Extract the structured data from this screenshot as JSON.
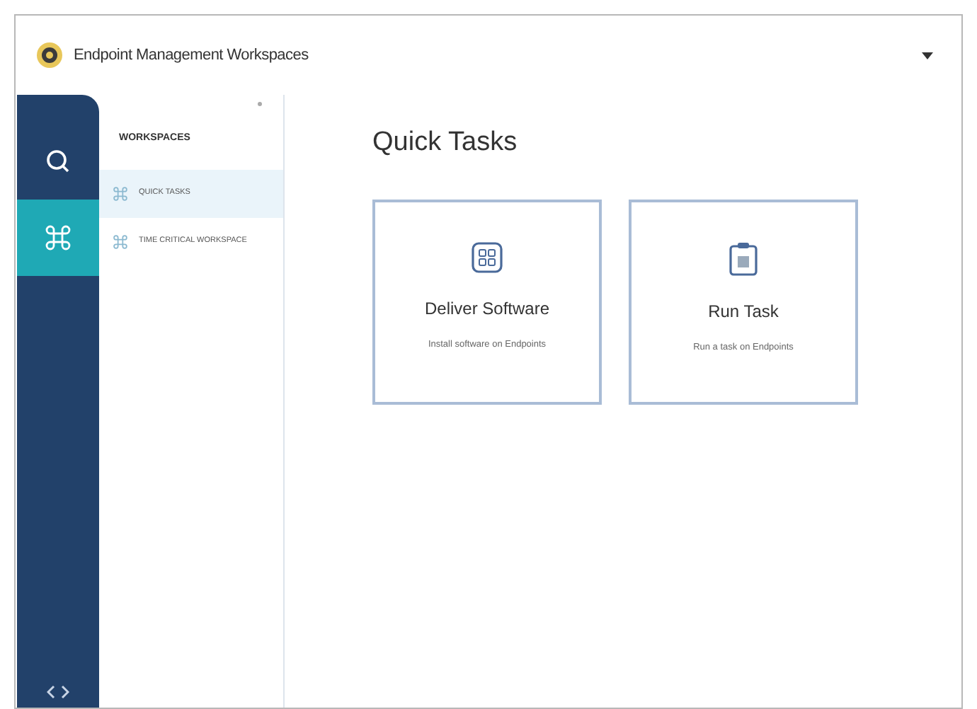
{
  "header": {
    "title": "Endpoint Management Workspaces"
  },
  "nav": [
    {
      "kind": "search",
      "selected": false
    },
    {
      "kind": "workspaces",
      "selected": true
    }
  ],
  "sidebar": {
    "heading": "WORKSPACES",
    "items": [
      {
        "label": "QUICK TASKS",
        "selected": true
      },
      {
        "label": "TIME CRITICAL WORKSPACE",
        "selected": false
      }
    ]
  },
  "main": {
    "title": "Quick Tasks",
    "cards": [
      {
        "kind": "software",
        "title": "Deliver Software",
        "subtitle": "Install software on Endpoints"
      },
      {
        "kind": "task",
        "title": "Run Task",
        "subtitle": "Run a task on Endpoints"
      }
    ]
  }
}
